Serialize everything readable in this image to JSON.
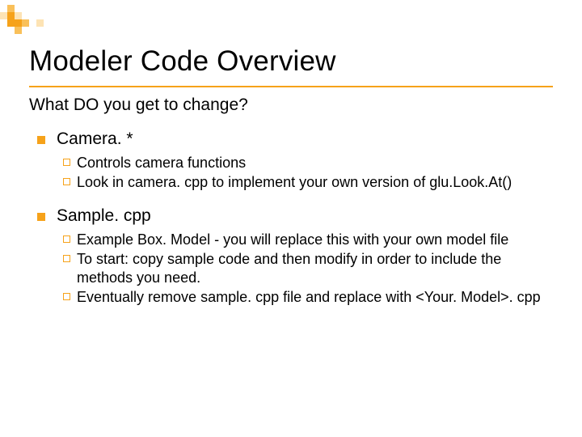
{
  "slide": {
    "title": "Modeler Code Overview",
    "subtitle": "What DO you get to change?",
    "items": [
      {
        "title": "Camera. *",
        "subs": [
          "Controls camera functions",
          "Look in camera. cpp to implement your own version of glu.Look.At()"
        ]
      },
      {
        "title": "Sample. cpp",
        "subs": [
          "Example Box. Model - you will replace this with your own model file",
          "To start: copy sample code and then modify in order to include the methods you need.",
          "Eventually remove sample. cpp file and replace with <Your. Model>. cpp"
        ]
      }
    ]
  }
}
